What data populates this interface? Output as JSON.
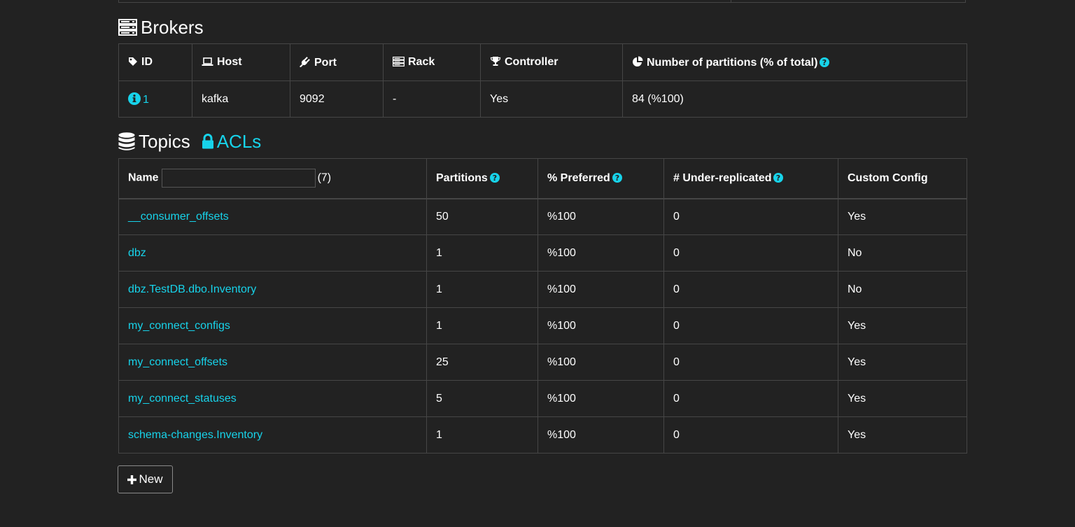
{
  "brokers": {
    "title": "Brokers",
    "columns": {
      "id": "ID",
      "host": "Host",
      "port": "Port",
      "rack": "Rack",
      "controller": "Controller",
      "partitions": "Number of partitions (% of total)"
    },
    "rows": [
      {
        "id": "1",
        "host": "kafka",
        "port": "9092",
        "rack": "-",
        "controller": "Yes",
        "partitions": "84 (%100)"
      }
    ]
  },
  "topics": {
    "title": "Topics",
    "acls_label": "ACLs",
    "columns": {
      "name": "Name",
      "count": "(7)",
      "partitions": "Partitions",
      "preferred": "% Preferred",
      "under_replicated": "# Under-replicated",
      "custom_config": "Custom Config"
    },
    "filter": {
      "value": "",
      "placeholder": ""
    },
    "rows": [
      {
        "name": "__consumer_offsets",
        "partitions": "50",
        "preferred": "%100",
        "under_replicated": "0",
        "custom_config": "Yes"
      },
      {
        "name": "dbz",
        "partitions": "1",
        "preferred": "%100",
        "under_replicated": "0",
        "custom_config": "No"
      },
      {
        "name": "dbz.TestDB.dbo.Inventory",
        "partitions": "1",
        "preferred": "%100",
        "under_replicated": "0",
        "custom_config": "No"
      },
      {
        "name": "my_connect_configs",
        "partitions": "1",
        "preferred": "%100",
        "under_replicated": "0",
        "custom_config": "Yes"
      },
      {
        "name": "my_connect_offsets",
        "partitions": "25",
        "preferred": "%100",
        "under_replicated": "0",
        "custom_config": "Yes"
      },
      {
        "name": "my_connect_statuses",
        "partitions": "5",
        "preferred": "%100",
        "under_replicated": "0",
        "custom_config": "Yes"
      },
      {
        "name": "schema-changes.Inventory",
        "partitions": "1",
        "preferred": "%100",
        "under_replicated": "0",
        "custom_config": "Yes"
      }
    ],
    "new_button_label": "New"
  },
  "colors": {
    "background": "#222222",
    "accent": "#17d3ea",
    "border": "#464646",
    "text": "#ffffff"
  },
  "icons": {
    "brokers_title": "server-icon",
    "topics_title": "database-icon",
    "acls": "lock-icon",
    "id": "tag-icon",
    "host": "laptop-icon",
    "port": "plug-icon",
    "rack": "server-icon",
    "controller": "trophy-icon",
    "partitions": "pie-chart-icon",
    "help": "question-circle-icon",
    "info": "info-circle-icon",
    "new": "plus-icon"
  }
}
